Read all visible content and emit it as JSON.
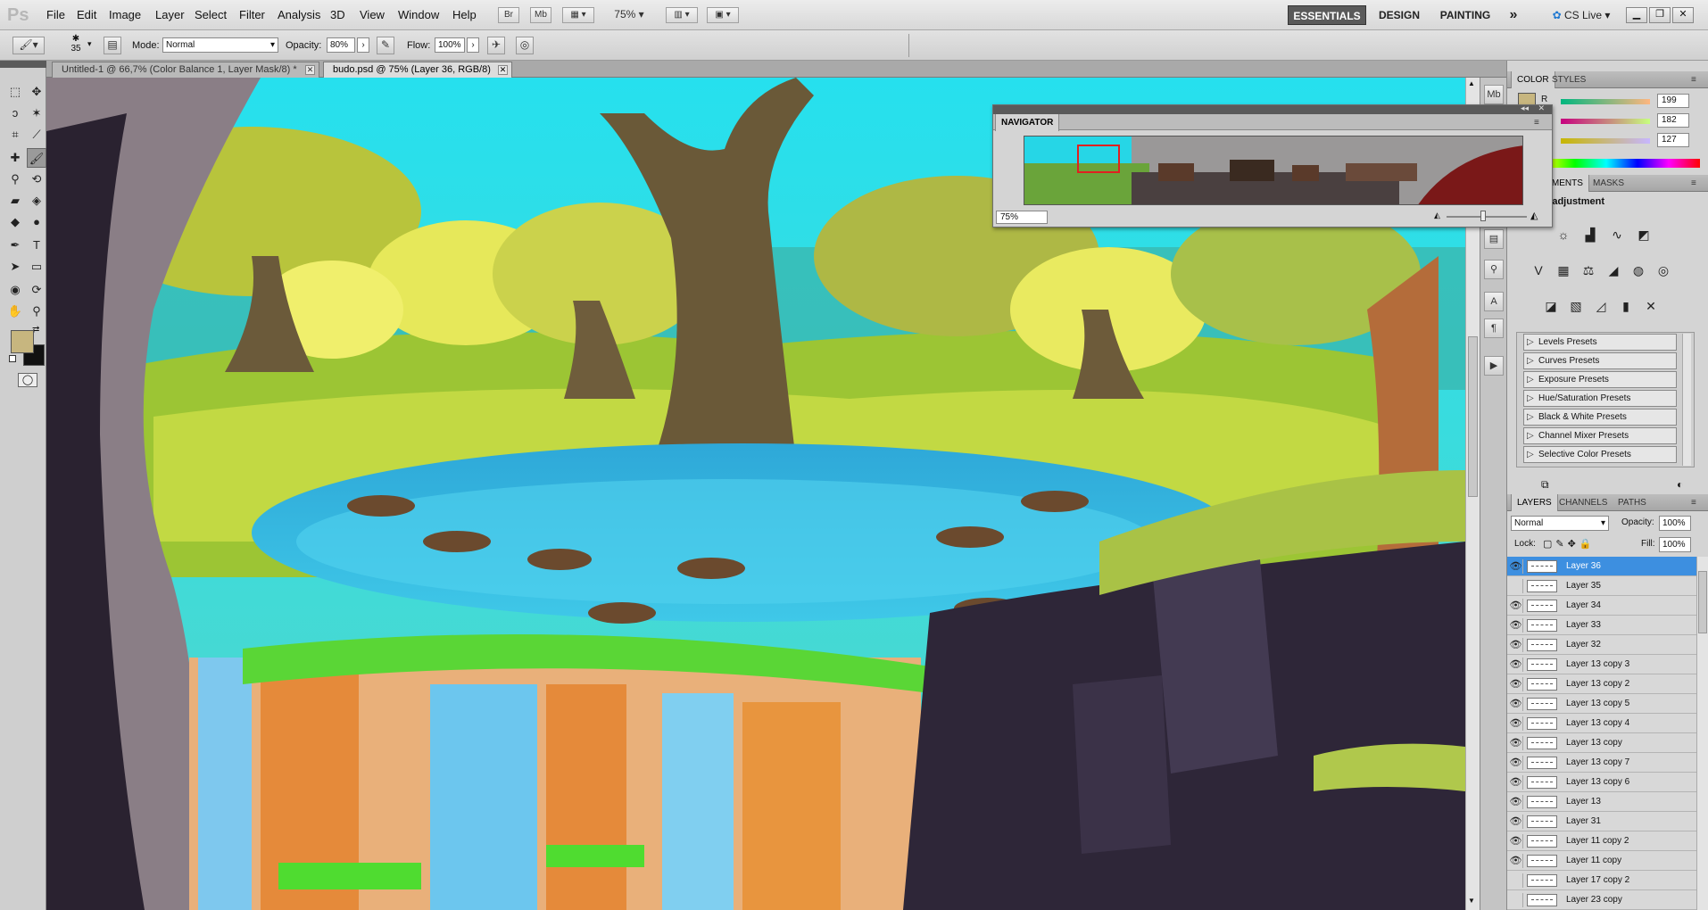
{
  "app": {
    "logo": "Ps"
  },
  "menu": [
    "File",
    "Edit",
    "Image",
    "Layer",
    "Select",
    "Filter",
    "Analysis",
    "3D",
    "View",
    "Window",
    "Help"
  ],
  "appbar": {
    "bridge": "Br",
    "minibridge": "Mb",
    "zoom": "75%"
  },
  "workspaces": {
    "essentials": "ESSENTIALS",
    "design": "DESIGN",
    "painting": "PAINTING",
    "more": "»",
    "cslive": "CS Live"
  },
  "options": {
    "brush_size": "35",
    "mode_label": "Mode:",
    "mode_value": "Normal",
    "opacity_label": "Opacity:",
    "opacity_value": "80%",
    "flow_label": "Flow:",
    "flow_value": "100%"
  },
  "doc_tabs": [
    {
      "label": "Untitled-1 @ 66,7% (Color Balance 1, Layer Mask/8) *",
      "active": false
    },
    {
      "label": "budo.psd @ 75% (Layer 36, RGB/8)",
      "active": true
    }
  ],
  "color_panel": {
    "tabs": [
      "COLOR",
      "STYLES"
    ],
    "channels": [
      {
        "name": "R",
        "value": "199"
      },
      {
        "name": "G",
        "value": "182"
      },
      {
        "name": "B",
        "value": "127"
      }
    ],
    "fg_color": "#c7b67f"
  },
  "adjustments_panel": {
    "tabs": [
      "ADJUSTMENTS",
      "MASKS"
    ],
    "heading": "Add an adjustment",
    "presets": [
      "Levels Presets",
      "Curves Presets",
      "Exposure Presets",
      "Hue/Saturation Presets",
      "Black & White Presets",
      "Channel Mixer Presets",
      "Selective Color Presets"
    ]
  },
  "layers_panel": {
    "tabs": [
      "LAYERS",
      "CHANNELS",
      "PATHS"
    ],
    "blend_mode": "Normal",
    "opacity_label": "Opacity:",
    "opacity_value": "100%",
    "lock_label": "Lock:",
    "fill_label": "Fill:",
    "fill_value": "100%",
    "layers": [
      {
        "name": "Layer 36",
        "visible": true,
        "selected": true
      },
      {
        "name": "Layer 35",
        "visible": false,
        "selected": false
      },
      {
        "name": "Layer 34",
        "visible": true,
        "selected": false
      },
      {
        "name": "Layer 33",
        "visible": true,
        "selected": false
      },
      {
        "name": "Layer 32",
        "visible": true,
        "selected": false
      },
      {
        "name": "Layer 13 copy 3",
        "visible": true,
        "selected": false
      },
      {
        "name": "Layer 13 copy 2",
        "visible": true,
        "selected": false
      },
      {
        "name": "Layer 13 copy 5",
        "visible": true,
        "selected": false
      },
      {
        "name": "Layer 13 copy 4",
        "visible": true,
        "selected": false
      },
      {
        "name": "Layer 13 copy",
        "visible": true,
        "selected": false
      },
      {
        "name": "Layer 13 copy 7",
        "visible": true,
        "selected": false
      },
      {
        "name": "Layer 13 copy 6",
        "visible": true,
        "selected": false
      },
      {
        "name": "Layer 13",
        "visible": true,
        "selected": false
      },
      {
        "name": "Layer 31",
        "visible": true,
        "selected": false
      },
      {
        "name": "Layer 11 copy 2",
        "visible": true,
        "selected": false
      },
      {
        "name": "Layer 11 copy",
        "visible": true,
        "selected": false
      },
      {
        "name": "Layer 17 copy 2",
        "visible": false,
        "selected": false
      },
      {
        "name": "Layer 23 copy",
        "visible": false,
        "selected": false
      }
    ]
  },
  "navigator": {
    "title": "NAVIGATOR",
    "zoom": "75%"
  }
}
